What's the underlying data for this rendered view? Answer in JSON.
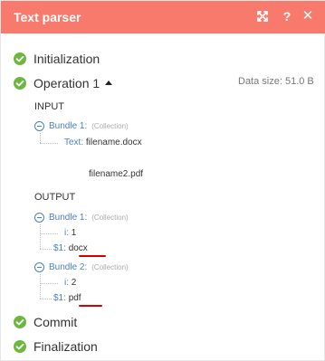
{
  "header": {
    "title": "Text parser",
    "expand_icon": "expand-icon",
    "help_label": "?",
    "close_label": "✕",
    "background": "#f77a6d"
  },
  "statuses": {
    "initialization": "Initialization",
    "operation": "Operation 1",
    "commit": "Commit",
    "finalization": "Finalization",
    "check_color": "#6cb83e"
  },
  "data_size": "Data size: 51.0 B",
  "input": {
    "label": "INPUT",
    "bundle_label": "Bundle 1:",
    "bundle_type": "(Collection)",
    "text_key": "Text:",
    "text_line1": "filename.docx",
    "text_line2": "filename2.pdf"
  },
  "output": {
    "label": "OUTPUT",
    "bundles": [
      {
        "label": "Bundle 1:",
        "type": "(Collection)",
        "i_key": "i:",
        "i_value": "1",
        "match_key": "$1:",
        "match_value": "docx"
      },
      {
        "label": "Bundle 2:",
        "type": "(Collection)",
        "i_key": "i:",
        "i_value": "2",
        "match_key": "$1:",
        "match_value": "pdf"
      }
    ]
  },
  "colors": {
    "key": "#4a7fc1",
    "underline": "#d40000"
  }
}
